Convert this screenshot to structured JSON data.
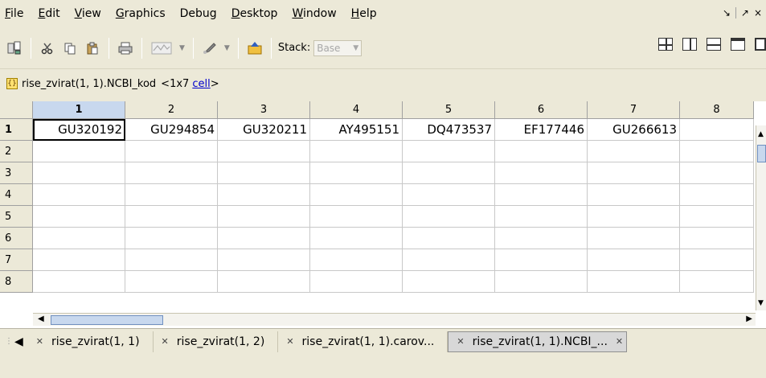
{
  "menubar": {
    "items": [
      "File",
      "Edit",
      "View",
      "Graphics",
      "Debug",
      "Desktop",
      "Window",
      "Help"
    ],
    "window_controls": {
      "undock": "↘",
      "dock": "↗",
      "close": "×"
    }
  },
  "toolbar": {
    "icons": [
      "variable-editor-icon",
      "cut-icon",
      "copy-icon",
      "paste-icon",
      "print-icon",
      "plot-icon",
      "brush-icon",
      "workspace-up-icon"
    ],
    "stack_label": "Stack:",
    "stack_value": "Base"
  },
  "pathbar": {
    "variable": "rise_zvirat(1, 1).NCBI_kod",
    "size": "<1x7",
    "class_link": "cell",
    "suffix": ">"
  },
  "grid": {
    "columns": [
      "1",
      "2",
      "3",
      "4",
      "5",
      "6",
      "7",
      "8"
    ],
    "rows": [
      "1",
      "2",
      "3",
      "4",
      "5",
      "6",
      "7",
      "8"
    ],
    "row1": [
      "GU320192",
      "GU294854",
      "GU320211",
      "AY495151",
      "DQ473537",
      "EF177446",
      "GU266613",
      ""
    ]
  },
  "tabs": [
    {
      "label": "rise_zvirat(1, 1)"
    },
    {
      "label": "rise_zvirat(1, 2)"
    },
    {
      "label": "rise_zvirat(1, 1).carov..."
    },
    {
      "label": "rise_zvirat(1, 1).NCBI_..."
    }
  ]
}
